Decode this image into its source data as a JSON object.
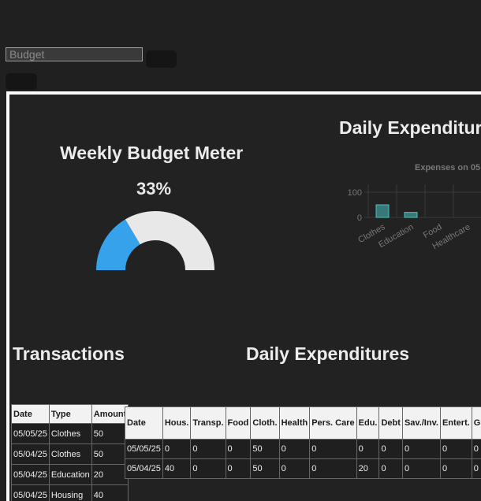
{
  "budget": {
    "placeholder": "Budget"
  },
  "meter": {
    "title": "Weekly Budget Meter",
    "percent_label": "33%",
    "percent": 33,
    "fill_color": "#36a2eb",
    "track_color": "#e8e8e8"
  },
  "daily_chart": {
    "section_title": "Daily Expenditur"
  },
  "transactions": {
    "title": "Transactions",
    "headers": [
      "Date",
      "Type",
      "Amount"
    ],
    "rows": [
      [
        "05/05/25",
        "Clothes",
        "50"
      ],
      [
        "05/04/25",
        "Clothes",
        "50"
      ],
      [
        "05/04/25",
        "Education",
        "20"
      ],
      [
        "05/04/25",
        "Housing",
        "40"
      ]
    ]
  },
  "daily_table": {
    "title": "Daily Expenditures",
    "headers": [
      "Date",
      "Hous.",
      "Transp.",
      "Food",
      "Cloth.",
      "Health",
      "Pers. Care",
      "Edu.",
      "Debt",
      "Sav./Inv.",
      "Entert.",
      "Gifts/Don."
    ],
    "rows": [
      [
        "05/05/25",
        "0",
        "0",
        "0",
        "50",
        "0",
        "0",
        "0",
        "0",
        "0",
        "0",
        "0"
      ],
      [
        "05/04/25",
        "40",
        "0",
        "0",
        "50",
        "0",
        "0",
        "20",
        "0",
        "0",
        "0",
        "0"
      ]
    ]
  },
  "chart_data": {
    "type": "bar",
    "title": "Expenses on 05",
    "categories": [
      "Clothes",
      "Education",
      "Food",
      "Healthcare"
    ],
    "series": [
      {
        "values": [
          50,
          20,
          0,
          0
        ],
        "color": "#4bc0c0"
      }
    ],
    "yticks": [
      0,
      100
    ],
    "ylim": [
      0,
      100
    ],
    "grid": true
  }
}
